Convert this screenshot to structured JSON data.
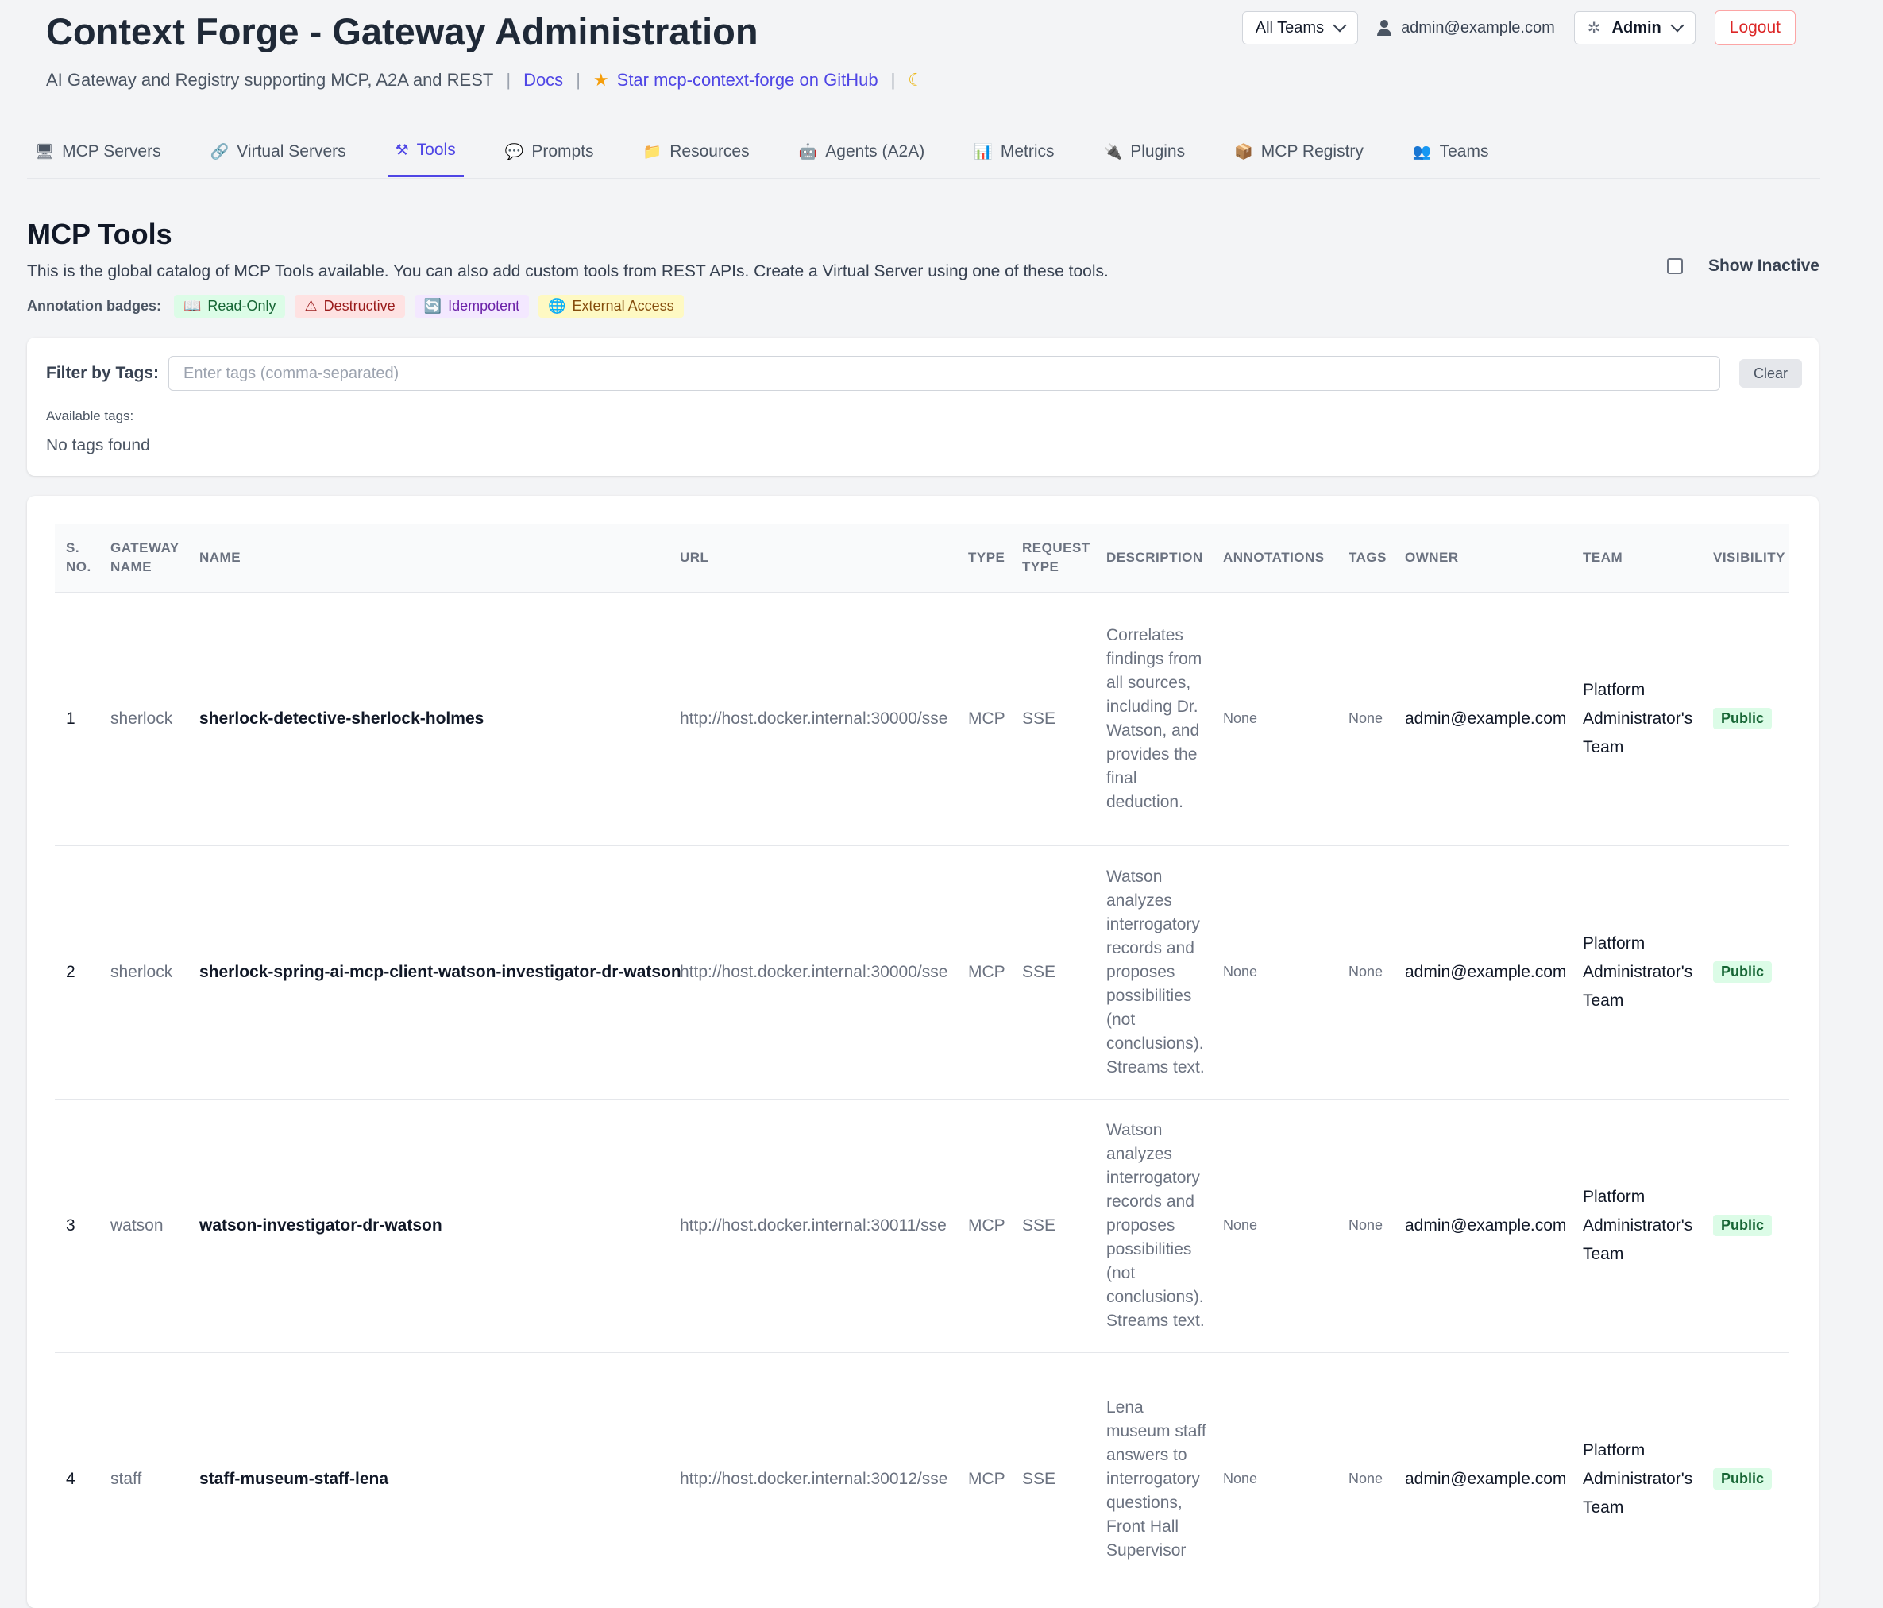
{
  "header": {
    "title": "Context Forge - Gateway Administration",
    "subtitle": "AI Gateway and Registry supporting MCP, A2A and REST",
    "docs_link": "Docs",
    "github_link": "Star mcp-context-forge on GitHub",
    "sep": "|",
    "star_icon": "★",
    "theme_icon": "☾"
  },
  "topbar": {
    "team_select": "All Teams",
    "user_email": "admin@example.com",
    "role_select": "Admin",
    "gear_icon": "✲",
    "logout": "Logout"
  },
  "tabs": [
    {
      "label": "MCP Servers",
      "icon": "🖥"
    },
    {
      "label": "Virtual Servers",
      "icon": "🔗"
    },
    {
      "label": "Tools",
      "icon": "⚒"
    },
    {
      "label": "Prompts",
      "icon": "💬"
    },
    {
      "label": "Resources",
      "icon": "📁"
    },
    {
      "label": "Agents (A2A)",
      "icon": "🤖"
    },
    {
      "label": "Metrics",
      "icon": "📊"
    },
    {
      "label": "Plugins",
      "icon": "🔌"
    },
    {
      "label": "MCP Registry",
      "icon": "📦"
    },
    {
      "label": "Teams",
      "icon": "👥"
    }
  ],
  "active_tab": "Tools",
  "section": {
    "title": "MCP Tools",
    "description": "This is the global catalog of MCP Tools available. You can also add custom tools from REST APIs. Create a Virtual Server using one of these tools.",
    "show_inactive": "Show Inactive"
  },
  "annotation_badges": {
    "label": "Annotation badges:",
    "read_only": {
      "label": "Read-Only",
      "icon": "📖"
    },
    "destructive": {
      "label": "Destructive",
      "icon": "⚠"
    },
    "idempotent": {
      "label": "Idempotent",
      "icon": "🔄"
    },
    "external": {
      "label": "External Access",
      "icon": "🌐"
    }
  },
  "filter": {
    "label": "Filter by Tags:",
    "placeholder": "Enter tags (comma-separated)",
    "clear": "Clear",
    "available_label": "Available tags:",
    "no_tags": "No tags found"
  },
  "table": {
    "headers": {
      "sno_1": "S.",
      "sno_2": "NO.",
      "gateway_1": "GATEWAY",
      "gateway_2": "NAME",
      "name": "NAME",
      "url": "URL",
      "type": "TYPE",
      "request_1": "REQUEST",
      "request_2": "TYPE",
      "description": "DESCRIPTION",
      "annotations": "ANNOTATIONS",
      "tags": "TAGS",
      "owner": "OWNER",
      "team": "TEAM",
      "visibility": "VISIBILITY"
    },
    "rows": [
      {
        "sno": "1",
        "gateway": "sherlock",
        "name": "sherlock-detective-sherlock-holmes",
        "url": "http://host.docker.internal:30000/sse",
        "type": "MCP",
        "request_type": "SSE",
        "description": "Correlates findings from all sources, including Dr. Watson, and provides the final deduction.",
        "annotations": "None",
        "tags": "None",
        "owner": "admin@example.com",
        "team": "Platform Administrator's Team",
        "visibility": "Public"
      },
      {
        "sno": "2",
        "gateway": "sherlock",
        "name": "sherlock-spring-ai-mcp-client-watson-investigator-dr-watson",
        "url": "http://host.docker.internal:30000/sse",
        "type": "MCP",
        "request_type": "SSE",
        "description": "Watson analyzes interrogatory records and proposes possibilities (not conclusions). Streams text.",
        "annotations": "None",
        "tags": "None",
        "owner": "admin@example.com",
        "team": "Platform Administrator's Team",
        "visibility": "Public"
      },
      {
        "sno": "3",
        "gateway": "watson",
        "name": "watson-investigator-dr-watson",
        "url": "http://host.docker.internal:30011/sse",
        "type": "MCP",
        "request_type": "SSE",
        "description": "Watson analyzes interrogatory records and proposes possibilities (not conclusions). Streams text.",
        "annotations": "None",
        "tags": "None",
        "owner": "admin@example.com",
        "team": "Platform Administrator's Team",
        "visibility": "Public"
      },
      {
        "sno": "4",
        "gateway": "staff",
        "name": "staff-museum-staff-lena",
        "url": "http://host.docker.internal:30012/sse",
        "type": "MCP",
        "request_type": "SSE",
        "description": "Lena museum staff answers to interrogatory questions, Front Hall Supervisor",
        "annotations": "None",
        "tags": "None",
        "owner": "admin@example.com",
        "team": "Platform Administrator's Team",
        "visibility": "Public"
      }
    ]
  }
}
